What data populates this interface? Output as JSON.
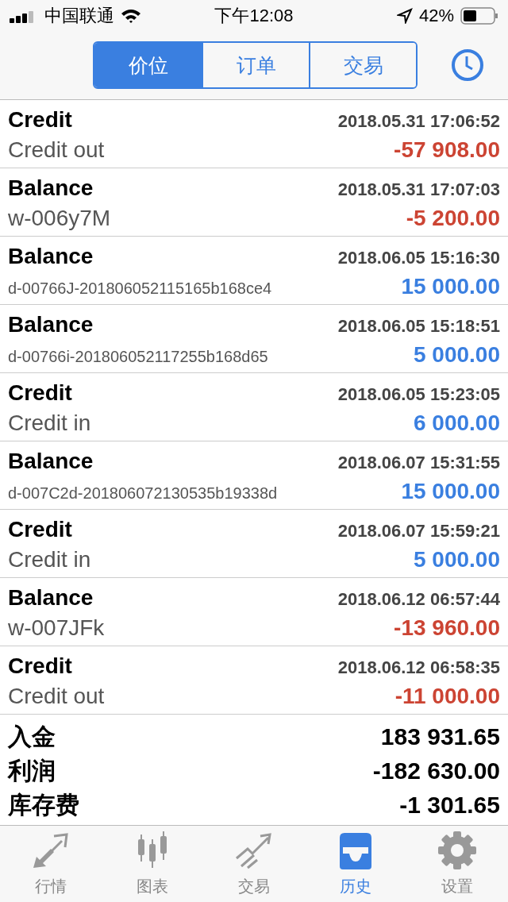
{
  "status_bar": {
    "carrier": "中国联通",
    "time": "下午12:08",
    "battery": "42%"
  },
  "segments": [
    {
      "label": "价位",
      "selected": true
    },
    {
      "label": "订单",
      "selected": false
    },
    {
      "label": "交易",
      "selected": false
    }
  ],
  "entries": [
    {
      "type": "Credit",
      "time": "2018.05.31 17:06:52",
      "comment": "Credit out",
      "amount": "-57 908.00",
      "negative": true
    },
    {
      "type": "Balance",
      "time": "2018.05.31 17:07:03",
      "comment": "w-006y7M",
      "amount": "-5 200.00",
      "negative": true
    },
    {
      "type": "Balance",
      "time": "2018.06.05 15:16:30",
      "comment": "d-00766J-201806052115165b168ce4",
      "amount": "15 000.00",
      "negative": false
    },
    {
      "type": "Balance",
      "time": "2018.06.05 15:18:51",
      "comment": "d-00766i-201806052117255b168d65",
      "amount": "5 000.00",
      "negative": false
    },
    {
      "type": "Credit",
      "time": "2018.06.05 15:23:05",
      "comment": "Credit in",
      "amount": "6 000.00",
      "negative": false
    },
    {
      "type": "Balance",
      "time": "2018.06.07 15:31:55",
      "comment": "d-007C2d-201806072130535b19338d",
      "amount": "15 000.00",
      "negative": false
    },
    {
      "type": "Credit",
      "time": "2018.06.07 15:59:21",
      "comment": "Credit in",
      "amount": "5 000.00",
      "negative": false
    },
    {
      "type": "Balance",
      "time": "2018.06.12 06:57:44",
      "comment": "w-007JFk",
      "amount": "-13 960.00",
      "negative": true
    },
    {
      "type": "Credit",
      "time": "2018.06.12 06:58:35",
      "comment": "Credit out",
      "amount": "-11 000.00",
      "negative": true
    }
  ],
  "summary": [
    {
      "label": "入金",
      "value": "183 931.65"
    },
    {
      "label": "利润",
      "value": "-182 630.00"
    },
    {
      "label": "库存费",
      "value": "-1 301.65"
    }
  ],
  "tab_bar": [
    {
      "label": "行情",
      "kind": "arrows",
      "selected": false
    },
    {
      "label": "图表",
      "kind": "candles",
      "selected": false
    },
    {
      "label": "交易",
      "kind": "trend",
      "selected": false
    },
    {
      "label": "历史",
      "kind": "inbox",
      "selected": true
    },
    {
      "label": "设置",
      "kind": "gear",
      "selected": false
    }
  ]
}
